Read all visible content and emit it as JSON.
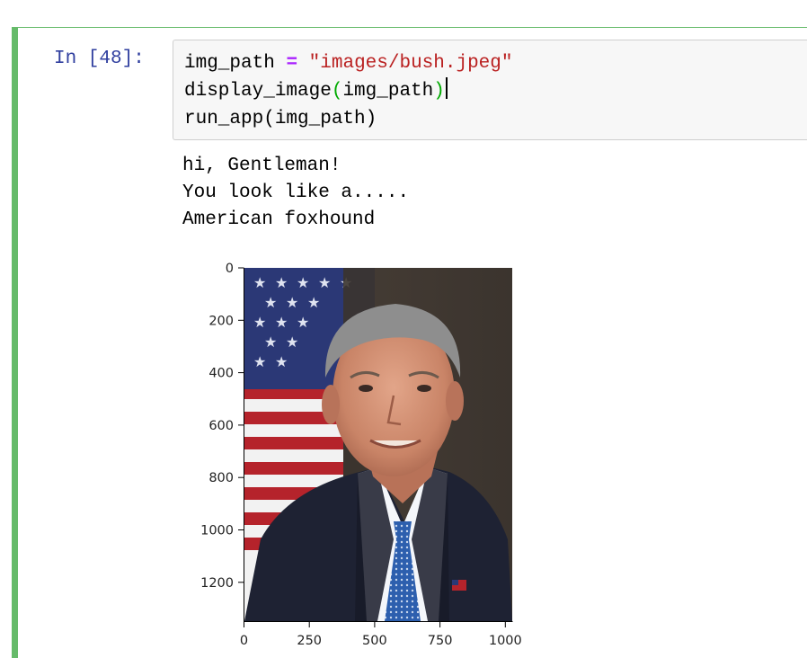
{
  "cell": {
    "prompt": "In [48]:",
    "code": {
      "line1": {
        "var": "img_path",
        "op": "=",
        "str": "\"images/bush.jpeg\""
      },
      "line2": {
        "fn": "display_image",
        "open": "(",
        "arg": "img_path",
        "close": ")"
      },
      "line3": {
        "text": "run_app(img_path)"
      }
    },
    "output_lines": [
      "hi, Gentleman!",
      "You look like a.....",
      "American foxhound"
    ]
  },
  "figure": {
    "image_subject": "portrait-photo",
    "y_ticks": [
      "0",
      "200",
      "400",
      "600",
      "800",
      "1000",
      "1200"
    ],
    "x_ticks": [
      "0",
      "250",
      "500",
      "750",
      "1000"
    ]
  },
  "colors": {
    "prompt": "#303f9f",
    "cell_border": "#66bb6a",
    "string": "#ba2121",
    "operator": "#aa22ff",
    "paren": "#00aa00"
  }
}
